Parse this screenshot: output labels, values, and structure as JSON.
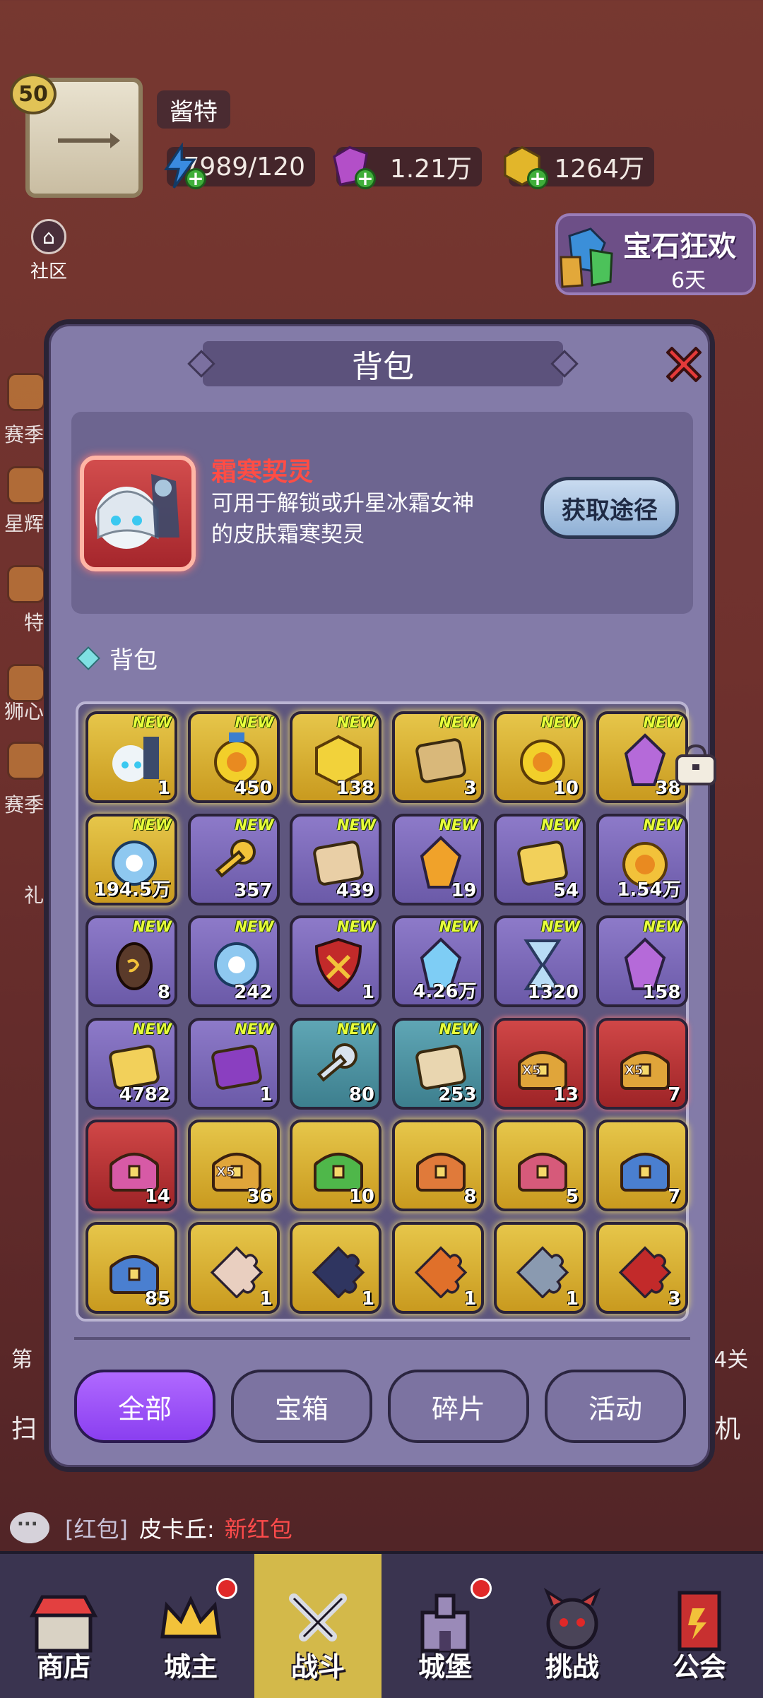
{
  "player": {
    "level": "50",
    "name": "酱特"
  },
  "resources": [
    {
      "name": "stamina",
      "value": "7989/120",
      "color": "#3a8be0"
    },
    {
      "name": "gem",
      "value": "1.21万",
      "color": "#b34fc8"
    },
    {
      "name": "gold",
      "value": "1264万",
      "color": "#e2b62a"
    }
  ],
  "community_label": "社区",
  "event": {
    "title": "宝石狂欢",
    "days": "6天"
  },
  "side_labels": {
    "l1": "赛季",
    "l2": "星辉",
    "l3": "特",
    "l4": "狮心",
    "l5": "赛季",
    "l6": "礼",
    "l7": "第",
    "l8": "扫",
    "r1": "4关",
    "r2": "机"
  },
  "modal": {
    "title": "背包",
    "selected": {
      "name": "霜寒契灵",
      "description": "可用于解锁或升星冰霜女神的皮肤霜寒契灵",
      "get_button": "获取途径"
    },
    "section_label": "背包",
    "new_label": "NEW",
    "items": [
      {
        "name": "frost-spirit-fragment",
        "rarity": "gold",
        "new": true,
        "count": "1"
      },
      {
        "name": "medal",
        "rarity": "gold",
        "new": true,
        "count": "450"
      },
      {
        "name": "gold-hexagon-coin",
        "rarity": "gold",
        "new": true,
        "count": "138"
      },
      {
        "name": "rune-stone",
        "rarity": "gold",
        "new": true,
        "count": "3"
      },
      {
        "name": "gold-coin",
        "rarity": "gold",
        "new": true,
        "count": "10"
      },
      {
        "name": "purple-crystal",
        "rarity": "gold",
        "new": true,
        "count": "38"
      },
      {
        "name": "blue-orb",
        "rarity": "gold",
        "new": true,
        "count": "194.5万"
      },
      {
        "name": "gold-key",
        "rarity": "purple",
        "new": true,
        "count": "357"
      },
      {
        "name": "sun-emblem",
        "rarity": "purple",
        "new": true,
        "count": "439"
      },
      {
        "name": "fire-crystal",
        "rarity": "purple",
        "new": true,
        "count": "19"
      },
      {
        "name": "spell-book",
        "rarity": "purple",
        "new": true,
        "count": "54"
      },
      {
        "name": "star-coin",
        "rarity": "purple",
        "new": true,
        "count": "1.54万"
      },
      {
        "name": "dragon-egg",
        "rarity": "purple",
        "new": true,
        "count": "8"
      },
      {
        "name": "compass",
        "rarity": "purple",
        "new": true,
        "count": "242"
      },
      {
        "name": "shield",
        "rarity": "purple",
        "new": true,
        "count": "1"
      },
      {
        "name": "ice-crystal",
        "rarity": "purple",
        "new": true,
        "count": "4.26万"
      },
      {
        "name": "hourglass",
        "rarity": "purple",
        "new": true,
        "count": "1320"
      },
      {
        "name": "amethyst",
        "rarity": "purple",
        "new": true,
        "count": "158"
      },
      {
        "name": "gold-ticket",
        "rarity": "purple",
        "new": true,
        "count": "4782"
      },
      {
        "name": "magic-card",
        "rarity": "purple",
        "new": true,
        "count": "1"
      },
      {
        "name": "silver-key",
        "rarity": "blue",
        "new": true,
        "count": "80"
      },
      {
        "name": "stone-tablet",
        "rarity": "blue",
        "new": true,
        "count": "253"
      },
      {
        "name": "x5-chest-red",
        "rarity": "red",
        "new": false,
        "count": "13"
      },
      {
        "name": "x5-chest-red-2",
        "rarity": "red",
        "new": false,
        "count": "7"
      },
      {
        "name": "pink-chest",
        "rarity": "red",
        "new": false,
        "count": "14"
      },
      {
        "name": "x5-chest-gold",
        "rarity": "gold",
        "new": false,
        "count": "36"
      },
      {
        "name": "green-chest",
        "rarity": "gold",
        "new": false,
        "count": "10"
      },
      {
        "name": "crown-chest",
        "rarity": "gold",
        "new": false,
        "count": "8"
      },
      {
        "name": "sword-chest",
        "rarity": "gold",
        "new": false,
        "count": "5"
      },
      {
        "name": "mystery-chest",
        "rarity": "gold",
        "new": false,
        "count": "7"
      },
      {
        "name": "mystery-chest-blue",
        "rarity": "gold",
        "new": false,
        "count": "85"
      },
      {
        "name": "puzzle-angel",
        "rarity": "gold",
        "new": false,
        "count": "1"
      },
      {
        "name": "puzzle-dark",
        "rarity": "gold",
        "new": false,
        "count": "1"
      },
      {
        "name": "puzzle-fire",
        "rarity": "gold",
        "new": false,
        "count": "1"
      },
      {
        "name": "puzzle-knight",
        "rarity": "gold",
        "new": false,
        "count": "1"
      },
      {
        "name": "puzzle-demon",
        "rarity": "gold",
        "new": false,
        "count": "3"
      }
    ],
    "tabs": [
      "全部",
      "宝箱",
      "碎片",
      "活动"
    ],
    "active_tab": 0
  },
  "chat": {
    "channel": "[红包]",
    "sender": "皮卡丘:",
    "message": "新红包",
    "channel_color": "#c9c2d8",
    "message_color": "#ff4b4b"
  },
  "nav": [
    {
      "label": "商店",
      "icon": "shop-icon",
      "badge": false
    },
    {
      "label": "城主",
      "icon": "crown-icon",
      "badge": true
    },
    {
      "label": "战斗",
      "icon": "swords-icon",
      "badge": false,
      "active": true
    },
    {
      "label": "城堡",
      "icon": "castle-icon",
      "badge": true
    },
    {
      "label": "挑战",
      "icon": "demon-icon",
      "badge": false
    },
    {
      "label": "公会",
      "icon": "guild-banner-icon",
      "badge": false
    }
  ]
}
